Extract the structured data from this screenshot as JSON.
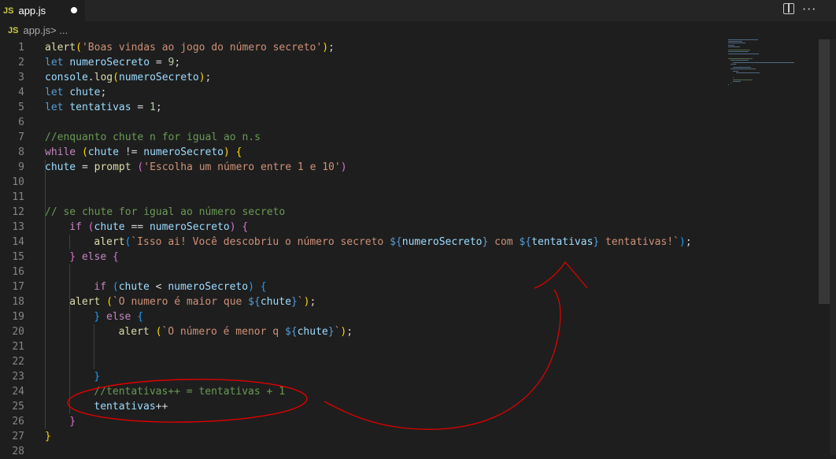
{
  "tab": {
    "badge": "JS",
    "label": "app.js"
  },
  "breadcrumb": {
    "badge": "JS",
    "file": "app.js",
    "sep": " > ..."
  },
  "toolbar": {
    "more": "···"
  },
  "colors": {
    "keyword": "#569cd6",
    "control": "#c586c0",
    "function": "#dcdcaa",
    "variable": "#9cdcfe",
    "string": "#ce9178",
    "number": "#b5cea8",
    "comment": "#6a9955",
    "bracket1": "#ffd700",
    "bracket2": "#da70d6",
    "bracket3": "#179fff",
    "annotation": "#e00000"
  },
  "lines": [
    {
      "n": "1",
      "indent": 0,
      "t": [
        [
          "alert",
          "fn"
        ],
        [
          "(",
          "b1"
        ],
        [
          "'Boas vindas ao jogo do número secreto'",
          "str"
        ],
        [
          ")",
          "b1"
        ],
        [
          ";",
          "p"
        ]
      ]
    },
    {
      "n": "2",
      "indent": 0,
      "t": [
        [
          "let ",
          "kw"
        ],
        [
          "numeroSecreto",
          "var"
        ],
        [
          " = ",
          "p"
        ],
        [
          "9",
          "num"
        ],
        [
          ";",
          "p"
        ]
      ]
    },
    {
      "n": "3",
      "indent": 0,
      "t": [
        [
          "console",
          "var"
        ],
        [
          ".",
          "p"
        ],
        [
          "log",
          "fn"
        ],
        [
          "(",
          "b1"
        ],
        [
          "numeroSecreto",
          "var"
        ],
        [
          ")",
          "b1"
        ],
        [
          ";",
          "p"
        ]
      ]
    },
    {
      "n": "4",
      "indent": 0,
      "t": [
        [
          "let ",
          "kw"
        ],
        [
          "chute",
          "var"
        ],
        [
          ";",
          "p"
        ]
      ]
    },
    {
      "n": "5",
      "indent": 0,
      "t": [
        [
          "let ",
          "kw"
        ],
        [
          "tentativas",
          "var"
        ],
        [
          " = ",
          "p"
        ],
        [
          "1",
          "num"
        ],
        [
          ";",
          "p"
        ]
      ]
    },
    {
      "n": "6",
      "indent": 0,
      "t": []
    },
    {
      "n": "7",
      "indent": 0,
      "t": [
        [
          "//enquanto chute n for igual ao n.s",
          "cm"
        ]
      ]
    },
    {
      "n": "8",
      "indent": 0,
      "t": [
        [
          "while",
          "ctl"
        ],
        [
          " ",
          "p"
        ],
        [
          "(",
          "b1"
        ],
        [
          "chute",
          "var"
        ],
        [
          " != ",
          "p"
        ],
        [
          "numeroSecreto",
          "var"
        ],
        [
          ")",
          "b1"
        ],
        [
          " ",
          "p"
        ],
        [
          "{",
          "b1"
        ]
      ]
    },
    {
      "n": "9",
      "indent": 0,
      "t": [
        [
          "chute",
          "var"
        ],
        [
          " = ",
          "p"
        ],
        [
          "prompt",
          "fn"
        ],
        [
          " ",
          "p"
        ],
        [
          "(",
          "b2"
        ],
        [
          "'Escolha um número entre 1 e 10'",
          "str"
        ],
        [
          ")",
          "b2"
        ]
      ]
    },
    {
      "n": "10",
      "indent": 0,
      "t": []
    },
    {
      "n": "11",
      "indent": 0,
      "t": []
    },
    {
      "n": "12",
      "indent": 0,
      "t": [
        [
          "// se chute for igual ao número secreto",
          "cm"
        ]
      ]
    },
    {
      "n": "13",
      "indent": 4,
      "t": [
        [
          "if",
          "ctl"
        ],
        [
          " ",
          "p"
        ],
        [
          "(",
          "b2"
        ],
        [
          "chute",
          "var"
        ],
        [
          " == ",
          "p"
        ],
        [
          "numeroSecreto",
          "var"
        ],
        [
          ")",
          "b2"
        ],
        [
          " ",
          "p"
        ],
        [
          "{",
          "b2"
        ]
      ]
    },
    {
      "n": "14",
      "indent": 8,
      "t": [
        [
          "alert",
          "fn"
        ],
        [
          "(",
          "b3"
        ],
        [
          "`Isso ai! Você descobriu o número secreto ",
          "str"
        ],
        [
          "${",
          "kw"
        ],
        [
          "numeroSecreto",
          "var"
        ],
        [
          "}",
          "kw"
        ],
        [
          " com ",
          "str"
        ],
        [
          "${",
          "kw"
        ],
        [
          "tentativas",
          "var"
        ],
        [
          "}",
          "kw"
        ],
        [
          " tentativas!`",
          "str"
        ],
        [
          ")",
          "b3"
        ],
        [
          ";",
          "p"
        ]
      ]
    },
    {
      "n": "15",
      "indent": 4,
      "t": [
        [
          "}",
          "b2"
        ],
        [
          " ",
          "p"
        ],
        [
          "else",
          "ctl"
        ],
        [
          " ",
          "p"
        ],
        [
          "{",
          "b2"
        ]
      ]
    },
    {
      "n": "16",
      "indent": 0,
      "t": []
    },
    {
      "n": "17",
      "indent": 8,
      "t": [
        [
          "if",
          "ctl"
        ],
        [
          " ",
          "p"
        ],
        [
          "(",
          "b3"
        ],
        [
          "chute",
          "var"
        ],
        [
          " < ",
          "p"
        ],
        [
          "numeroSecreto",
          "var"
        ],
        [
          ")",
          "b3"
        ],
        [
          " ",
          "p"
        ],
        [
          "{",
          "b3"
        ]
      ]
    },
    {
      "n": "18",
      "indent": 4,
      "t": [
        [
          "alert",
          "fn"
        ],
        [
          " ",
          "p"
        ],
        [
          "(",
          "b1"
        ],
        [
          "`O numero é maior que ",
          "str"
        ],
        [
          "${",
          "kw"
        ],
        [
          "chute",
          "var"
        ],
        [
          "}",
          "kw"
        ],
        [
          "`",
          "str"
        ],
        [
          ")",
          "b1"
        ],
        [
          ";",
          "p"
        ]
      ]
    },
    {
      "n": "19",
      "indent": 8,
      "t": [
        [
          "}",
          "b3"
        ],
        [
          " ",
          "p"
        ],
        [
          "else",
          "ctl"
        ],
        [
          " ",
          "p"
        ],
        [
          "{",
          "b3"
        ]
      ]
    },
    {
      "n": "20",
      "indent": 12,
      "t": [
        [
          "alert",
          "fn"
        ],
        [
          " ",
          "p"
        ],
        [
          "(",
          "b1"
        ],
        [
          "`O número é menor q ",
          "str"
        ],
        [
          "${",
          "kw"
        ],
        [
          "chute",
          "var"
        ],
        [
          "}",
          "kw"
        ],
        [
          "`",
          "str"
        ],
        [
          ")",
          "b1"
        ],
        [
          ";",
          "p"
        ]
      ]
    },
    {
      "n": "21",
      "indent": 0,
      "t": []
    },
    {
      "n": "22",
      "indent": 0,
      "t": []
    },
    {
      "n": "23",
      "indent": 8,
      "t": [
        [
          "}",
          "b3"
        ]
      ]
    },
    {
      "n": "24",
      "indent": 8,
      "t": [
        [
          "//tentativas++ = tentativas + 1",
          "cm"
        ]
      ]
    },
    {
      "n": "25",
      "indent": 8,
      "t": [
        [
          "tentativas",
          "var"
        ],
        [
          "++",
          "p"
        ]
      ]
    },
    {
      "n": "26",
      "indent": 4,
      "t": [
        [
          "}",
          "b2"
        ]
      ]
    },
    {
      "n": "27",
      "indent": 0,
      "t": [
        [
          "}",
          "b1"
        ]
      ]
    },
    {
      "n": "28",
      "indent": 0,
      "t": []
    }
  ]
}
